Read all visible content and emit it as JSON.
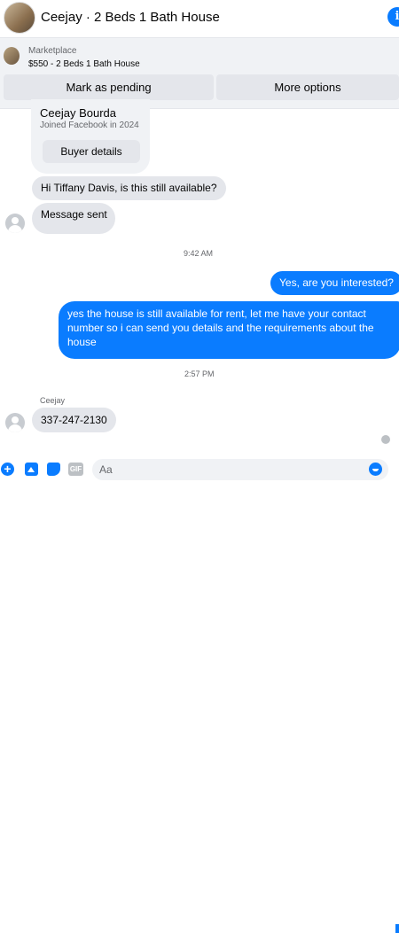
{
  "header": {
    "title": "Ceejay · 2 Beds 1 Bath House",
    "info_icon": "info-icon"
  },
  "marketplace": {
    "label": "Marketplace",
    "listing": "$550 - 2 Beds 1 Bath House",
    "mark_pending_label": "Mark as pending",
    "more_options_label": "More options"
  },
  "buyer_card": {
    "name": "Ceejay Bourda",
    "joined": "Joined Facebook in 2024",
    "details_label": "Buyer details"
  },
  "messages": [
    {
      "direction": "incoming",
      "text": "Hi Tiffany Davis, is this still available?"
    },
    {
      "direction": "incoming",
      "text": "Message sent"
    },
    {
      "direction": "timestamp",
      "text": "9:42 AM"
    },
    {
      "direction": "outgoing",
      "text": "Yes, are you interested?"
    },
    {
      "direction": "outgoing",
      "text": "yes the house is still available for rent, let me have your contact number so i can send you details and the requirements about the house"
    },
    {
      "direction": "timestamp",
      "text": "2:57 PM"
    },
    {
      "direction": "sender",
      "text": "Ceejay"
    },
    {
      "direction": "incoming",
      "text": "337-247-2130"
    }
  ],
  "composer": {
    "placeholder": "Aa",
    "icons": [
      "plus-icon",
      "image-icon",
      "sticker-icon",
      "gif-icon",
      "emoji-icon"
    ],
    "gif_label": "GIF"
  },
  "colors": {
    "accent": "#0a7cff",
    "incoming_bubble": "#e4e6eb",
    "panel": "#f0f2f5"
  }
}
